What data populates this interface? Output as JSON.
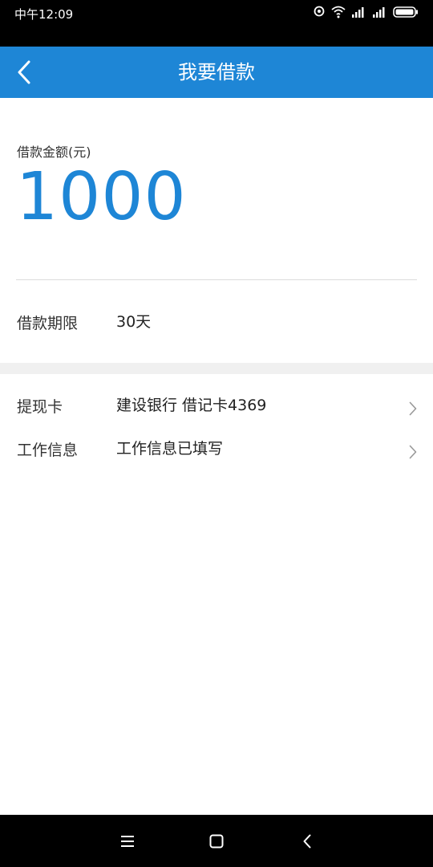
{
  "status_bar": {
    "time": "中午12:09"
  },
  "header": {
    "title": "我要借款",
    "back_icon": "chevron-left-icon"
  },
  "loan": {
    "amount_label": "借款金额(元)",
    "amount_value": "1000",
    "term_label": "借款期限",
    "term_value": "30天"
  },
  "rows": [
    {
      "label": "提现卡",
      "value": "建设银行 借记卡4369",
      "icon": "chevron-right-icon"
    },
    {
      "label": "工作信息",
      "value": "工作信息已填写",
      "icon": "chevron-right-icon"
    }
  ],
  "colors": {
    "accent": "#1e86d6",
    "statusbar": "#000000",
    "separator": "#f0f0f0"
  },
  "nav": {
    "icons": [
      "menu-icon",
      "home-icon",
      "back-icon"
    ]
  }
}
